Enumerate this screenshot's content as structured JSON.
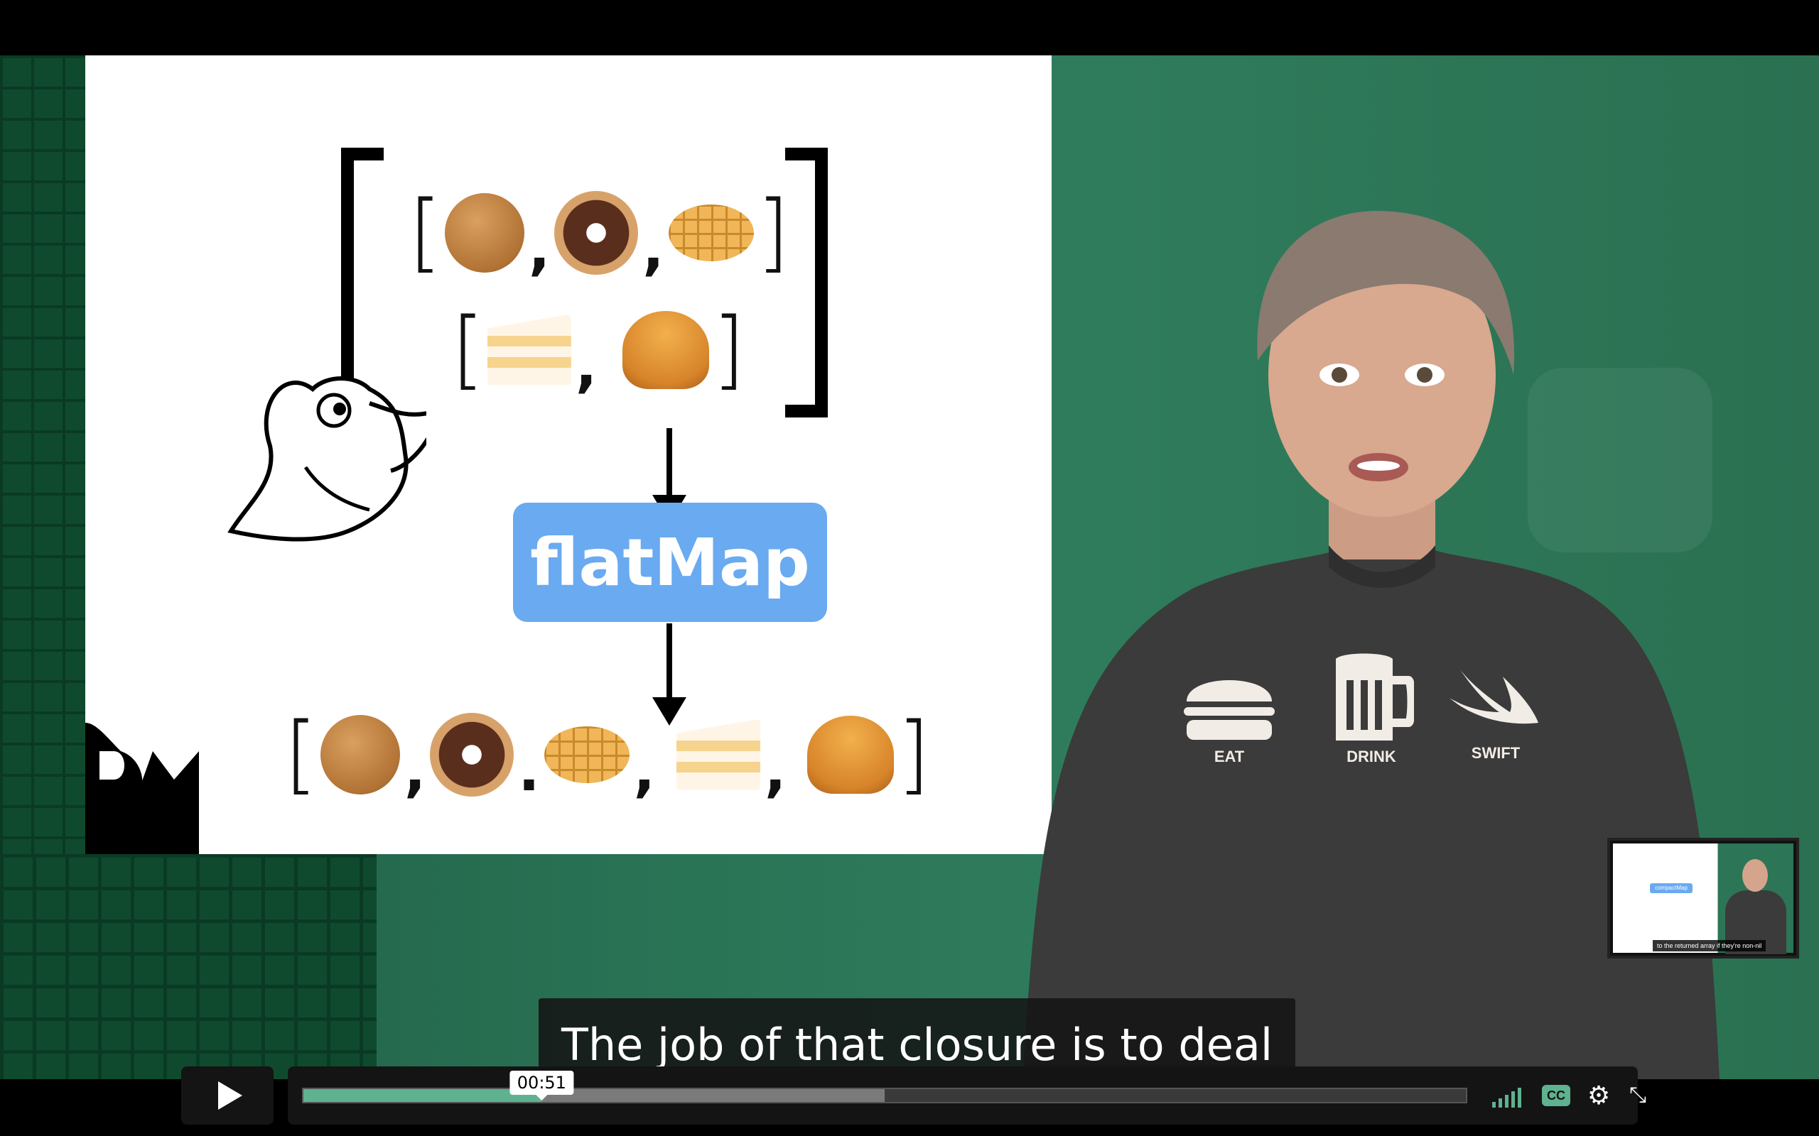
{
  "slide": {
    "method_label": "flatMap",
    "input_row_1": [
      "cookie",
      "donut",
      "waffle"
    ],
    "input_row_2": [
      "cake",
      "croissant"
    ],
    "output_row": [
      "cookie",
      "donut",
      "waffle",
      "cake",
      "croissant"
    ]
  },
  "caption": {
    "text": "The job of that closure is to deal"
  },
  "shirt": {
    "labels": [
      "EAT",
      "DRINK",
      "SWIFT"
    ]
  },
  "pip": {
    "method_label": "compactMap",
    "caption": "to the returned array if they're non-nil"
  },
  "player": {
    "hover_time": "00:51",
    "played_fraction": 0.205,
    "buffered_fraction": 0.5,
    "cc_label": "CC",
    "accent_color": "#5fb28f"
  },
  "icons": {
    "play": "play-icon",
    "volume": "volume-icon",
    "cc": "closed-captions-icon",
    "settings": "gear-icon",
    "fullscreen": "collapse-fullscreen-icon"
  }
}
